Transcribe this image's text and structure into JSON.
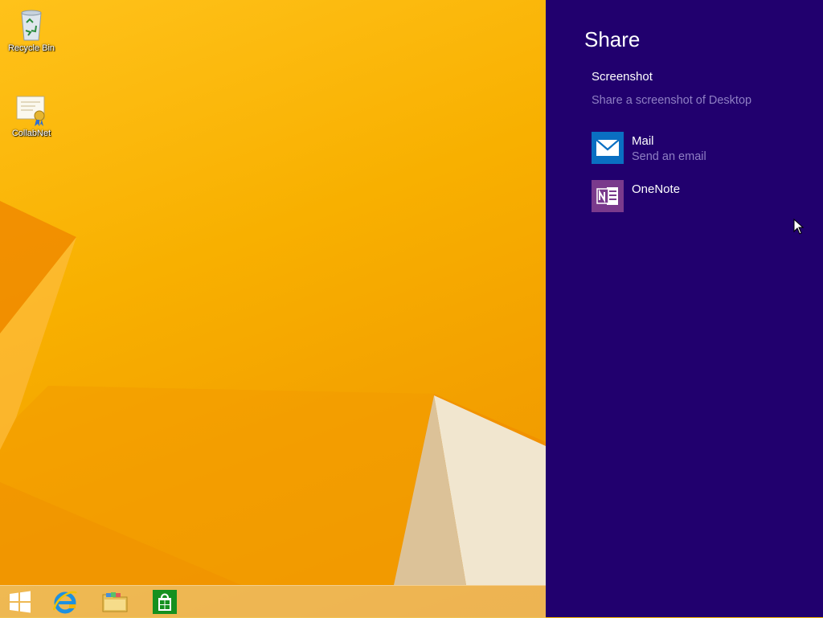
{
  "desktop": {
    "icons": [
      {
        "label": "Recycle Bin",
        "icon": "recycle-bin-icon"
      },
      {
        "label": "CollabNet",
        "icon": "certificate-icon"
      }
    ]
  },
  "taskbar": {
    "items": [
      {
        "name": "start",
        "icon": "windows-logo-icon"
      },
      {
        "name": "internet-explorer",
        "icon": "internet-explorer-icon"
      },
      {
        "name": "file-explorer",
        "icon": "folder-icon"
      },
      {
        "name": "store",
        "icon": "store-icon"
      }
    ]
  },
  "share": {
    "title": "Share",
    "source": "Screenshot",
    "description": "Share a screenshot of Desktop",
    "targets": [
      {
        "name": "Mail",
        "subtitle": "Send an email",
        "icon": "mail-icon",
        "color": "#0a6fc2"
      },
      {
        "name": "OneNote",
        "subtitle": "",
        "icon": "onenote-icon",
        "color": "#7a3a8c"
      }
    ]
  },
  "colors": {
    "charm_bg": "#21006e",
    "secondary_text": "#8f7fc4",
    "wallpaper": "#f7b500"
  }
}
